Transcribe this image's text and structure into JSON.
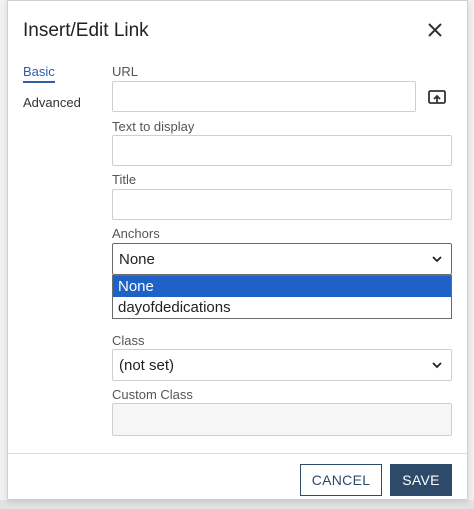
{
  "dialog": {
    "title": "Insert/Edit Link"
  },
  "tabs": [
    {
      "label": "Basic",
      "active": true
    },
    {
      "label": "Advanced",
      "active": false
    }
  ],
  "fields": {
    "url": {
      "label": "URL",
      "value": ""
    },
    "text_to_display": {
      "label": "Text to display",
      "value": ""
    },
    "title": {
      "label": "Title",
      "value": ""
    },
    "anchors": {
      "label": "Anchors",
      "selected": "None",
      "options": [
        "None",
        "dayofdedications"
      ]
    },
    "class": {
      "label": "Class",
      "selected": "(not set)"
    },
    "custom_class": {
      "label": "Custom Class",
      "value": ""
    }
  },
  "footer": {
    "cancel_label": "CANCEL",
    "save_label": "SAVE"
  },
  "colors": {
    "accent": "#2e4a6a",
    "tab_active": "#2b5fa8",
    "option_selected": "#1e62c8"
  },
  "icons": {
    "close": "close-icon",
    "browse": "browse-upload-icon",
    "chevron": "chevron-down-icon"
  }
}
